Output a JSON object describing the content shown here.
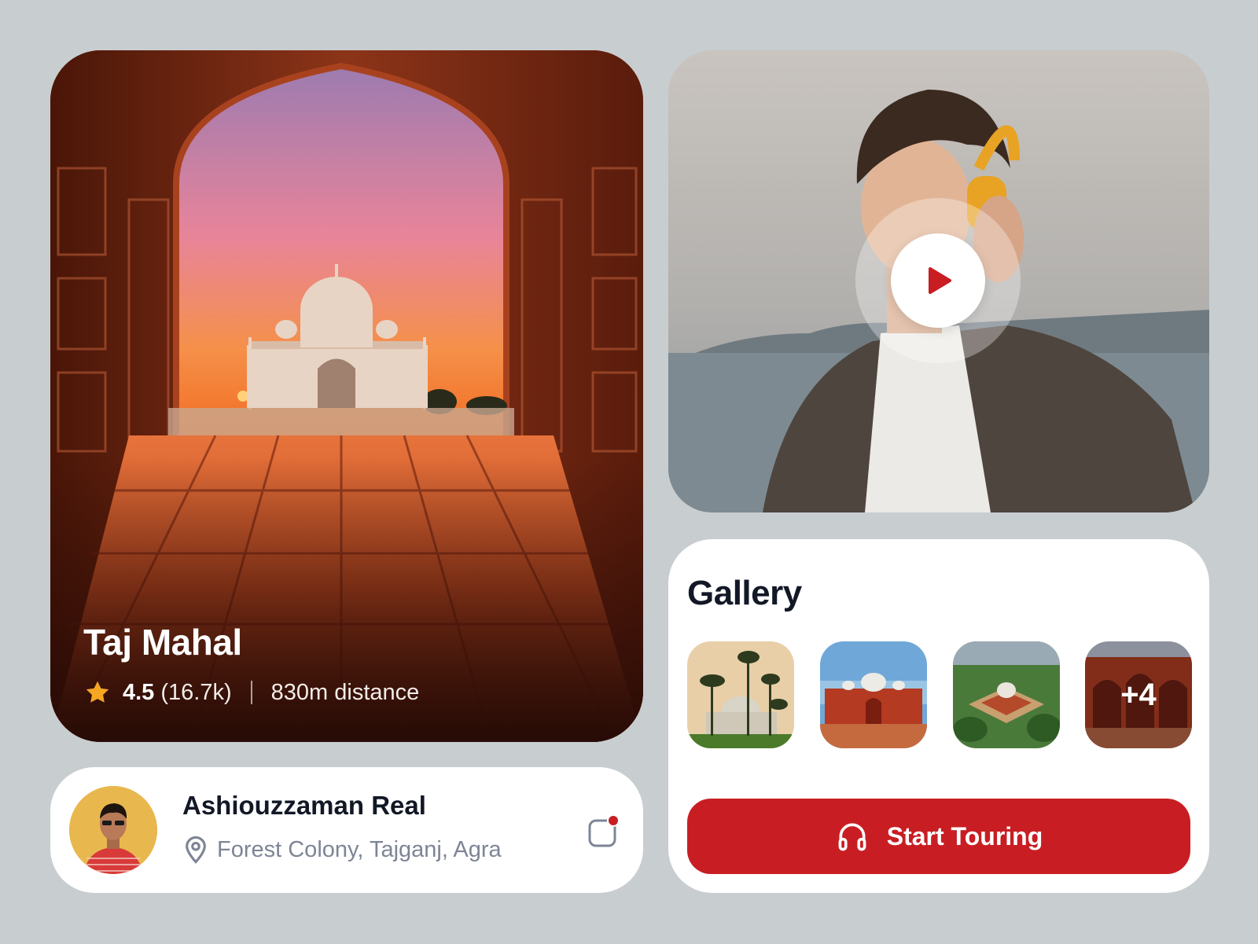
{
  "hero": {
    "title": "Taj Mahal",
    "rating": "4.5",
    "reviews": "(16.7k)",
    "distance": "830m distance",
    "star_icon": "star-icon",
    "star_color": "#f5a623"
  },
  "video": {
    "play_icon": "play-icon",
    "play_color": "#c81e23"
  },
  "profile": {
    "name": "Ashiouzzaman Real",
    "location": "Forest Colony, Tajganj, Agra",
    "location_icon": "location-pin-icon",
    "action_icon": "chat-notification-icon"
  },
  "gallery": {
    "title": "Gallery",
    "more_count": "+4",
    "thumbnails": [
      "tomb-with-palms",
      "red-mosque",
      "aerial-tomb",
      "red-archway"
    ]
  },
  "cta": {
    "label": "Start Touring",
    "icon": "headphones-icon",
    "color": "#c81e23"
  }
}
